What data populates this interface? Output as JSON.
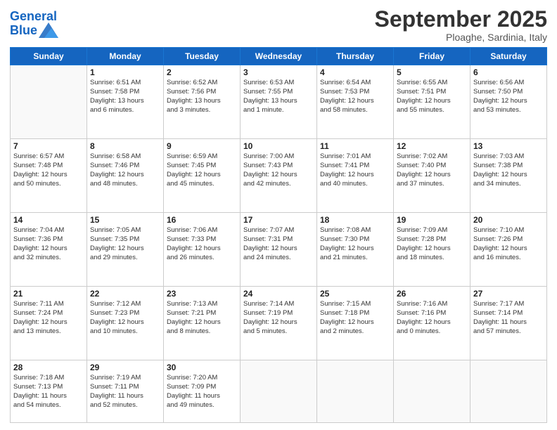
{
  "header": {
    "logo_line1": "General",
    "logo_line2": "Blue",
    "month": "September 2025",
    "location": "Ploaghe, Sardinia, Italy"
  },
  "weekdays": [
    "Sunday",
    "Monday",
    "Tuesday",
    "Wednesday",
    "Thursday",
    "Friday",
    "Saturday"
  ],
  "weeks": [
    [
      {
        "day": "",
        "info": ""
      },
      {
        "day": "1",
        "info": "Sunrise: 6:51 AM\nSunset: 7:58 PM\nDaylight: 13 hours\nand 6 minutes."
      },
      {
        "day": "2",
        "info": "Sunrise: 6:52 AM\nSunset: 7:56 PM\nDaylight: 13 hours\nand 3 minutes."
      },
      {
        "day": "3",
        "info": "Sunrise: 6:53 AM\nSunset: 7:55 PM\nDaylight: 13 hours\nand 1 minute."
      },
      {
        "day": "4",
        "info": "Sunrise: 6:54 AM\nSunset: 7:53 PM\nDaylight: 12 hours\nand 58 minutes."
      },
      {
        "day": "5",
        "info": "Sunrise: 6:55 AM\nSunset: 7:51 PM\nDaylight: 12 hours\nand 55 minutes."
      },
      {
        "day": "6",
        "info": "Sunrise: 6:56 AM\nSunset: 7:50 PM\nDaylight: 12 hours\nand 53 minutes."
      }
    ],
    [
      {
        "day": "7",
        "info": "Sunrise: 6:57 AM\nSunset: 7:48 PM\nDaylight: 12 hours\nand 50 minutes."
      },
      {
        "day": "8",
        "info": "Sunrise: 6:58 AM\nSunset: 7:46 PM\nDaylight: 12 hours\nand 48 minutes."
      },
      {
        "day": "9",
        "info": "Sunrise: 6:59 AM\nSunset: 7:45 PM\nDaylight: 12 hours\nand 45 minutes."
      },
      {
        "day": "10",
        "info": "Sunrise: 7:00 AM\nSunset: 7:43 PM\nDaylight: 12 hours\nand 42 minutes."
      },
      {
        "day": "11",
        "info": "Sunrise: 7:01 AM\nSunset: 7:41 PM\nDaylight: 12 hours\nand 40 minutes."
      },
      {
        "day": "12",
        "info": "Sunrise: 7:02 AM\nSunset: 7:40 PM\nDaylight: 12 hours\nand 37 minutes."
      },
      {
        "day": "13",
        "info": "Sunrise: 7:03 AM\nSunset: 7:38 PM\nDaylight: 12 hours\nand 34 minutes."
      }
    ],
    [
      {
        "day": "14",
        "info": "Sunrise: 7:04 AM\nSunset: 7:36 PM\nDaylight: 12 hours\nand 32 minutes."
      },
      {
        "day": "15",
        "info": "Sunrise: 7:05 AM\nSunset: 7:35 PM\nDaylight: 12 hours\nand 29 minutes."
      },
      {
        "day": "16",
        "info": "Sunrise: 7:06 AM\nSunset: 7:33 PM\nDaylight: 12 hours\nand 26 minutes."
      },
      {
        "day": "17",
        "info": "Sunrise: 7:07 AM\nSunset: 7:31 PM\nDaylight: 12 hours\nand 24 minutes."
      },
      {
        "day": "18",
        "info": "Sunrise: 7:08 AM\nSunset: 7:30 PM\nDaylight: 12 hours\nand 21 minutes."
      },
      {
        "day": "19",
        "info": "Sunrise: 7:09 AM\nSunset: 7:28 PM\nDaylight: 12 hours\nand 18 minutes."
      },
      {
        "day": "20",
        "info": "Sunrise: 7:10 AM\nSunset: 7:26 PM\nDaylight: 12 hours\nand 16 minutes."
      }
    ],
    [
      {
        "day": "21",
        "info": "Sunrise: 7:11 AM\nSunset: 7:24 PM\nDaylight: 12 hours\nand 13 minutes."
      },
      {
        "day": "22",
        "info": "Sunrise: 7:12 AM\nSunset: 7:23 PM\nDaylight: 12 hours\nand 10 minutes."
      },
      {
        "day": "23",
        "info": "Sunrise: 7:13 AM\nSunset: 7:21 PM\nDaylight: 12 hours\nand 8 minutes."
      },
      {
        "day": "24",
        "info": "Sunrise: 7:14 AM\nSunset: 7:19 PM\nDaylight: 12 hours\nand 5 minutes."
      },
      {
        "day": "25",
        "info": "Sunrise: 7:15 AM\nSunset: 7:18 PM\nDaylight: 12 hours\nand 2 minutes."
      },
      {
        "day": "26",
        "info": "Sunrise: 7:16 AM\nSunset: 7:16 PM\nDaylight: 12 hours\nand 0 minutes."
      },
      {
        "day": "27",
        "info": "Sunrise: 7:17 AM\nSunset: 7:14 PM\nDaylight: 11 hours\nand 57 minutes."
      }
    ],
    [
      {
        "day": "28",
        "info": "Sunrise: 7:18 AM\nSunset: 7:13 PM\nDaylight: 11 hours\nand 54 minutes."
      },
      {
        "day": "29",
        "info": "Sunrise: 7:19 AM\nSunset: 7:11 PM\nDaylight: 11 hours\nand 52 minutes."
      },
      {
        "day": "30",
        "info": "Sunrise: 7:20 AM\nSunset: 7:09 PM\nDaylight: 11 hours\nand 49 minutes."
      },
      {
        "day": "",
        "info": ""
      },
      {
        "day": "",
        "info": ""
      },
      {
        "day": "",
        "info": ""
      },
      {
        "day": "",
        "info": ""
      }
    ]
  ]
}
